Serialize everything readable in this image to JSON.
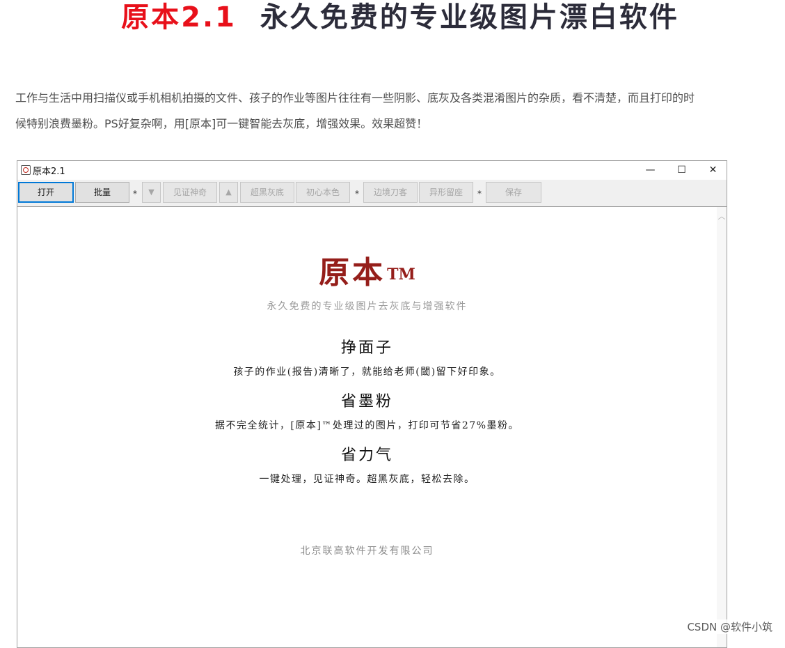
{
  "page": {
    "headline_version": "原本2.1",
    "headline_rest": "永久免费的专业级图片漂白软件",
    "intro_line1": "工作与生活中用扫描仪或手机相机拍摄的文件、孩子的作业等图片往往有一些阴影、底灰及各类混淆图片的杂质，看不清楚，而且打印的时",
    "intro_line2": "候特别浪费墨粉。PS好复杂啊，用[原本]可一键智能去灰底，增强效果。效果超赞！"
  },
  "window": {
    "title": "原本2.1",
    "controls": {
      "minimize": "—",
      "maximize": "☐",
      "close": "✕"
    }
  },
  "toolbar": {
    "open": "打开",
    "batch": "批量",
    "sep1": "*",
    "down_arrow": "▼",
    "magic": "见证神奇",
    "up_arrow": "▲",
    "super_black": "超黑灰底",
    "original_color": "初心本色",
    "sep2": "*",
    "edge_cut": "边境刀客",
    "irregular_crop": "异形留座",
    "sep3": "*",
    "save": "保存"
  },
  "content": {
    "logo": "原本",
    "logo_tm": "TM",
    "tagline": "永久免费的专业级图片去灰底与增强软件",
    "sections": [
      {
        "heading": "挣面子",
        "text": "孩子的作业(报告)清晰了，就能给老师(閾)留下好印象。"
      },
      {
        "heading": "省墨粉",
        "text": "据不完全统计，[原本]™处理过的图片，打印可节省27%墨粉。"
      },
      {
        "heading": "省力气",
        "text": "一键处理，见证神奇。超黑灰底，轻松去除。"
      }
    ],
    "company": "北京联高软件开发有限公司"
  },
  "watermark": "CSDN @软件小筑"
}
